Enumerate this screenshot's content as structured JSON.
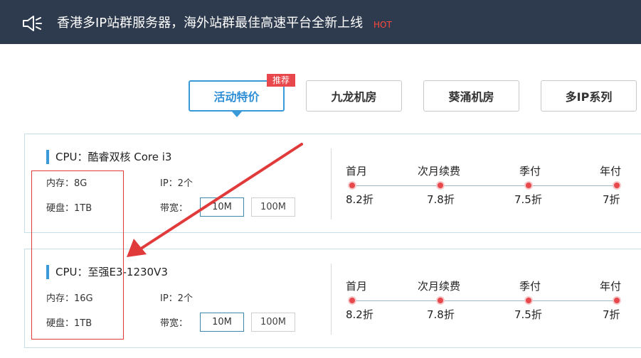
{
  "banner": {
    "text": "香港多IP站群服务器，海外站群最佳高速平台全新上线",
    "hot": "HOT",
    "icon": "speaker-icon",
    "background_color": "#2e3a4d"
  },
  "tabs": [
    {
      "label": "活动特价",
      "active": true,
      "badge": "推荐"
    },
    {
      "label": "九龙机房",
      "active": false
    },
    {
      "label": "葵涌机房",
      "active": false
    },
    {
      "label": "多IP系列",
      "active": false
    }
  ],
  "products": [
    {
      "cpu": "CPU：酷睿双核 Core i3",
      "memory": "内存：8G",
      "ip": "IP：2个",
      "disk": "硬盘：1TB",
      "bandwidth_label": "带宽：",
      "bandwidth_options": [
        "10M",
        "100M"
      ],
      "bandwidth_selected": "10M",
      "plans": [
        {
          "label": "首月",
          "value": "8.2折"
        },
        {
          "label": "次月续费",
          "value": "7.8折"
        },
        {
          "label": "季付",
          "value": "7.5折"
        },
        {
          "label": "年付",
          "value": "7折"
        }
      ]
    },
    {
      "cpu": "CPU：至强E3-1230V3",
      "memory": "内存：16G",
      "ip": "IP：2个",
      "disk": "硬盘：1TB",
      "bandwidth_label": "带宽：",
      "bandwidth_options": [
        "10M",
        "100M"
      ],
      "bandwidth_selected": "10M",
      "plans": [
        {
          "label": "首月",
          "value": "8.2折"
        },
        {
          "label": "次月续费",
          "value": "7.8折"
        },
        {
          "label": "季付",
          "value": "7.5折"
        },
        {
          "label": "年付",
          "value": "7折"
        }
      ]
    }
  ],
  "colors": {
    "accent": "#3a9ad9",
    "badge": "#e8474b",
    "annotation": "#e03a3a"
  }
}
